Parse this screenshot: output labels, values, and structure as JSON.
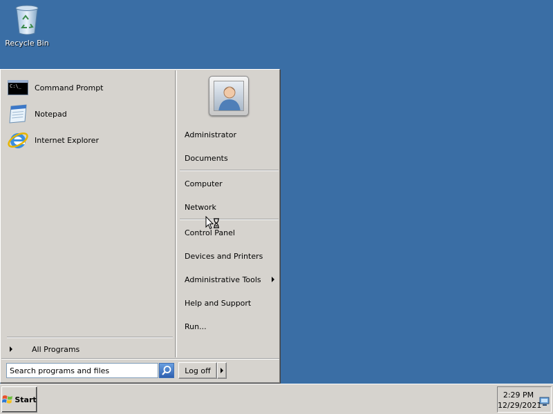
{
  "desktop": {
    "recycle_bin_label": "Recycle Bin"
  },
  "start_menu": {
    "pinned_programs": [
      {
        "label": "Command Prompt",
        "icon": "command-prompt-icon"
      },
      {
        "label": "Notepad",
        "icon": "notepad-icon"
      },
      {
        "label": "Internet Explorer",
        "icon": "internet-explorer-icon"
      }
    ],
    "all_programs_label": "All Programs",
    "search_placeholder": "Search programs and files",
    "right_items": [
      {
        "label": "Administrator"
      },
      {
        "label": "Documents"
      },
      {
        "label": "Computer"
      },
      {
        "label": "Network"
      },
      {
        "label": "Control Panel"
      },
      {
        "label": "Devices and Printers"
      },
      {
        "label": "Administrative Tools",
        "has_submenu": true
      },
      {
        "label": "Help and Support"
      },
      {
        "label": "Run..."
      }
    ],
    "logoff_label": "Log off"
  },
  "taskbar": {
    "start_label": "Start",
    "time": "2:29 PM",
    "date": "12/29/2021"
  },
  "colors": {
    "desktop": "#3a6ea5",
    "menu_face": "#d6d3ce"
  }
}
